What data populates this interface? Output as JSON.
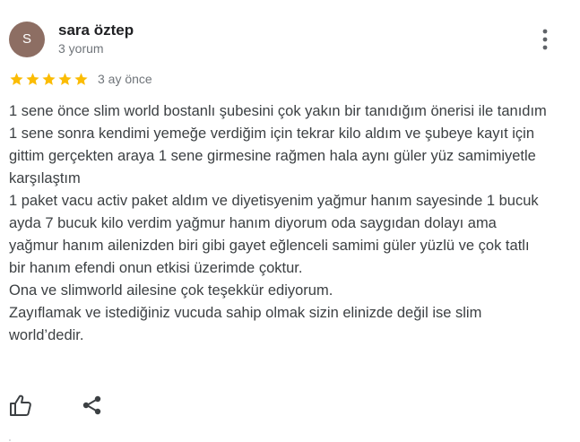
{
  "author": {
    "initial": "S",
    "name": "sara öztep",
    "meta": "3 yorum",
    "avatar_color": "#8d6e63"
  },
  "menu": {
    "icon": "more-vert-icon"
  },
  "rating": {
    "stars": 5,
    "max": 5,
    "star_color": "#fbbc04",
    "date": "3 ay önce"
  },
  "review": {
    "paragraphs": [
      "1 sene önce slim world bostanlı şubesini çok yakın bir tanıdığım önerisi ile tanıdım",
      "1 sene sonra kendimi yemeğe verdiğim için tekrar kilo aldım ve şubeye kayıt için gittim gerçekten araya 1 sene girmesine rağmen hala aynı güler yüz samimiyetle karşılaştım",
      "1 paket vacu activ paket aldım ve diyetisyenim yağmur hanım sayesinde 1 bucuk ayda 7 bucuk kilo verdim yağmur hanım diyorum oda saygıdan dolayı ama yağmur hanım ailenizden biri gibi gayet eğlenceli samimi güler yüzlü ve çok tatlı bir hanım efendi onun etkisi üzerimde çoktur.",
      "Ona ve slimworld ailesine çok teşekkür ediyorum.",
      "Zayıflamak ve istediğiniz vucuda sahip olmak sizin elinizde değil ise slim world’dedir."
    ]
  },
  "actions": {
    "like_icon": "thumb-up-icon",
    "share_icon": "share-icon"
  }
}
